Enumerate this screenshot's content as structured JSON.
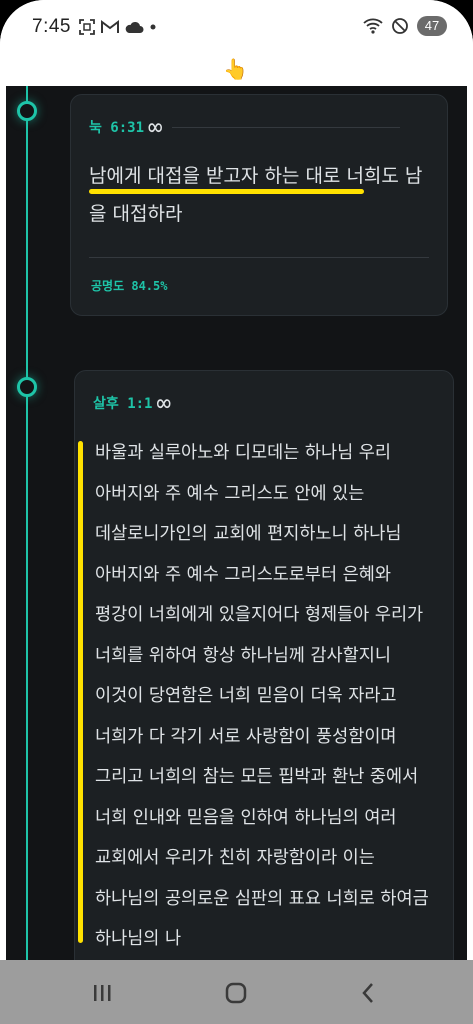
{
  "status_bar": {
    "time": "7:45",
    "battery": "47",
    "left_icons": [
      "screenshot-icon",
      "gmail-icon",
      "cloud-icon",
      "dot-icon"
    ],
    "right_icons": [
      "wifi-icon",
      "do-not-disturb-icon"
    ]
  },
  "header": {
    "pointer_emoji": "👆"
  },
  "cards": [
    {
      "reference": "눅 6:31",
      "infinity": "∞",
      "text_underlined": "남에게 대접을 받고자 하는 대로",
      "text_rest": " 너희도 남을 대접하라",
      "score": "공명도 84.5%"
    },
    {
      "reference": "살후 1:1",
      "infinity": "∞",
      "text": "바울과 실루아노와 디모데는 하나님 우리 아버지와 주 예수 그리스도 안에 있는 데살로니가인의 교회에 편지하노니 하나님 아버지와 주 예수 그리스도로부터 은혜와 평강이 너희에게 있을지어다 형제들아 우리가 너희를 위하여 항상 하나님께 감사할지니 이것이 당연함은 너희 믿음이 더욱 자라고 너희가 다 각기 서로 사랑함이 풍성함이며 그리고 너희의 참는 모든 핍박과 환난 중에서 너희 인내와 믿음을 인하여 하나님의 여러 교회에서 우리가 친히 자랑함이라 이는 하나님의 공의로운 심판의 표요 너희로 하여금 하나님의 나"
    }
  ],
  "colors": {
    "accent": "#1ec4a8",
    "highlight": "#ffe100",
    "background": "#121416",
    "card": "#1c2023"
  },
  "nav": {
    "recents_icon": "recents-icon",
    "home_icon": "home-icon",
    "back_icon": "back-icon"
  }
}
